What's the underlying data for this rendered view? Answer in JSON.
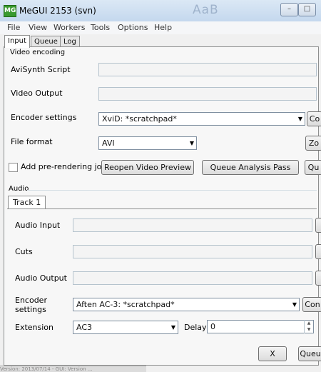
{
  "window": {
    "title": "MeGUI 2153 (svn)",
    "app_icon": "MG",
    "ghost_text": "AaB",
    "minimize": "–",
    "maximize": "□"
  },
  "menu": [
    "File",
    "View",
    "Workers",
    "Tools",
    "Options",
    "Help"
  ],
  "tabs": [
    "Input",
    "Queue",
    "Log"
  ],
  "video": {
    "section_label": "Video encoding",
    "avisynth_label": "AviSynth Script",
    "output_label": "Video Output",
    "encoder_label": "Encoder settings",
    "encoder_value": "XviD: *scratchpad*",
    "config_button": "Co",
    "format_label": "File format",
    "format_value": "AVI",
    "zone_button": "Zo",
    "prerender_label": "Add pre-rendering job",
    "preview_button": "Reopen Video Preview",
    "analysis_button": "Queue Analysis Pass",
    "queue_button": "Qu"
  },
  "audio": {
    "section_label": "Audio",
    "track_tab": "Track 1",
    "input_label": "Audio Input",
    "cuts_label": "Cuts",
    "output_label": "Audio Output",
    "encoder_label_line1": "Encoder",
    "encoder_label_line2": "settings",
    "encoder_value": "Aften AC-3: *scratchpad*",
    "config_button": "Con",
    "extension_label": "Extension",
    "extension_value": "AC3",
    "delay_label": "Delay",
    "delay_value": "0",
    "x_button": "X",
    "queue_button": "Queu"
  },
  "status": "Version: 2013/07/14 - GUI: Version ..."
}
